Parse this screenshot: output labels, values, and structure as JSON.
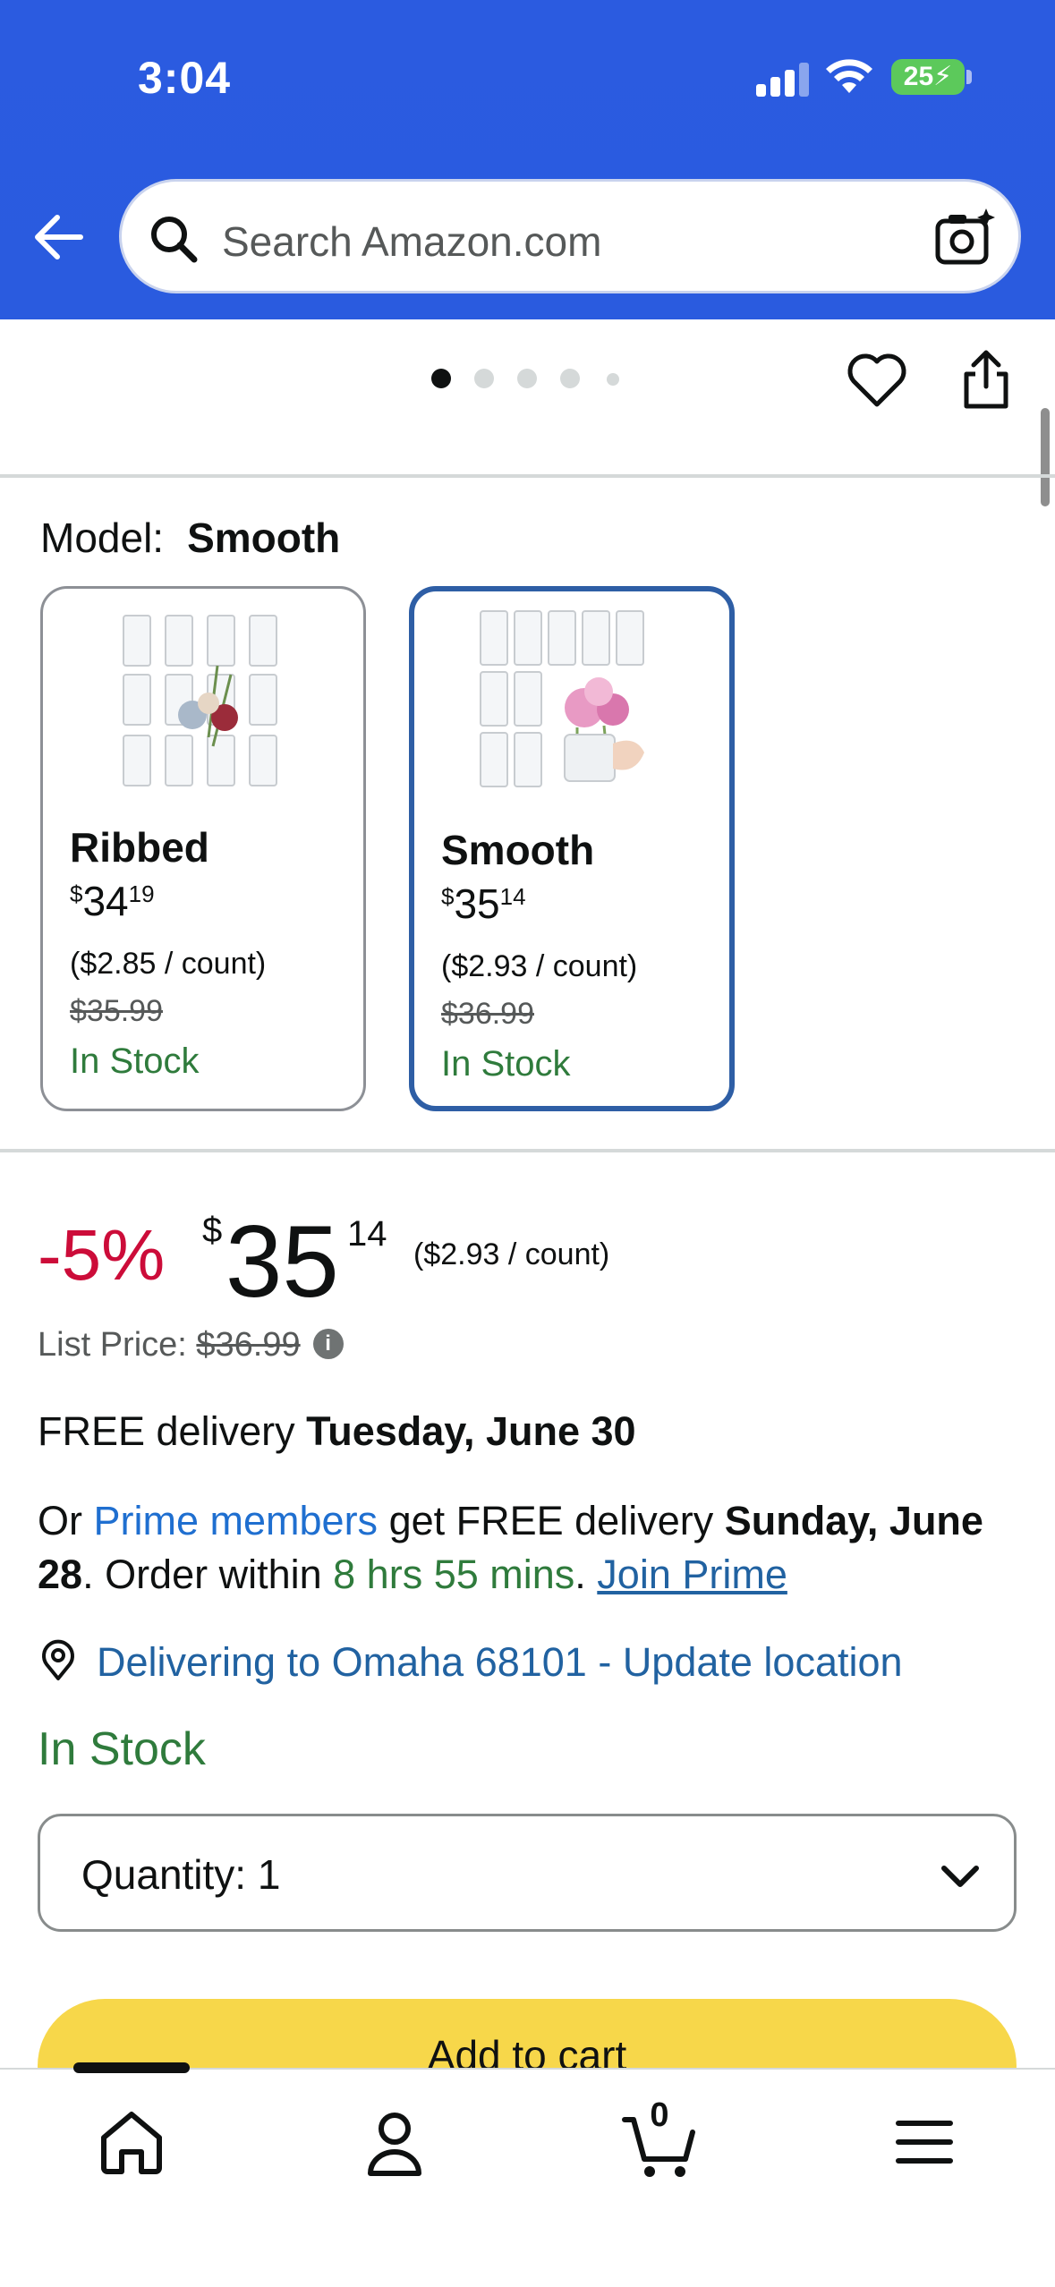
{
  "status_bar": {
    "time": "3:04",
    "battery": "25"
  },
  "search": {
    "placeholder": "Search Amazon.com"
  },
  "gallery": {
    "dots": 5,
    "active_index": 0
  },
  "model": {
    "label": "Model:",
    "selected": "Smooth",
    "options": [
      {
        "name": "Ribbed",
        "price_whole": "34",
        "price_fraction": "19",
        "currency": "$",
        "unit_price": "($2.85 / count)",
        "list_price": "$35.99",
        "stock": "In Stock",
        "selected": false
      },
      {
        "name": "Smooth",
        "price_whole": "35",
        "price_fraction": "14",
        "currency": "$",
        "unit_price": "($2.93 / count)",
        "list_price": "$36.99",
        "stock": "In Stock",
        "selected": true
      }
    ]
  },
  "price": {
    "discount": "-5%",
    "currency": "$",
    "whole": "35",
    "fraction": "14",
    "unit_price": "($2.93 / count)",
    "list_price_label": "List Price:",
    "list_price": "$36.99",
    "info_icon": "i"
  },
  "delivery": {
    "free_label": "FREE delivery ",
    "free_date": "Tuesday, June 30",
    "prime_or": "Or ",
    "prime_members": "Prime members",
    "prime_mid": " get FREE delivery ",
    "prime_date": "Sunday, June 28",
    "order_within_label": ". Order within ",
    "order_within": "8 hrs 55 mins",
    "period": ". ",
    "join_prime": "Join Prime"
  },
  "location": {
    "text": "Delivering to Omaha 68101 - Update location"
  },
  "stock_status": "In Stock",
  "quantity": {
    "label": "Quantity:",
    "value": "1"
  },
  "add_to_cart": "Add to cart",
  "tabbar": {
    "cart_count": "0"
  },
  "colors": {
    "header": "#2a5bdf",
    "selected_border": "#2e5ea5",
    "discount": "#cc0c39",
    "in_stock": "#2f7b3c",
    "link": "#2162a1",
    "cart_button": "#f7d74a"
  }
}
